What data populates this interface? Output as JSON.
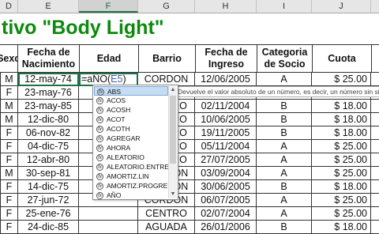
{
  "columns": [
    {
      "letter": "D",
      "active": false
    },
    {
      "letter": "E",
      "active": false
    },
    {
      "letter": "F",
      "active": true
    },
    {
      "letter": "G",
      "active": false
    },
    {
      "letter": "H",
      "active": false
    },
    {
      "letter": "I",
      "active": false
    },
    {
      "letter": "J",
      "active": false
    }
  ],
  "title": "tivo \"Body Light\"",
  "headers": [
    "Sexo",
    "Fecha de Nacimiento",
    "Edad",
    "Barrio",
    "Fecha de Ingreso",
    "Categoria de Socio",
    "Cuota"
  ],
  "rows": [
    [
      "M",
      "12-may-74",
      "",
      "CORDON",
      "12/06/2005",
      "A",
      "$ 25.00"
    ],
    [
      "F",
      "23-may-76",
      "",
      "",
      "",
      "",
      ""
    ],
    [
      "M",
      "23-may-85",
      "",
      "CENTRO",
      "02/11/2004",
      "B",
      "$ 18.00"
    ],
    [
      "M",
      "12-dic-80",
      "",
      "CENTRO",
      "10/06/2005",
      "B",
      "$ 18.00"
    ],
    [
      "F",
      "06-nov-82",
      "",
      "CENTRO",
      "19/11/2005",
      "B",
      "$ 18.00"
    ],
    [
      "F",
      "04-dic-75",
      "",
      "CENTRO",
      "05/11/2004",
      "A",
      "$ 25.00"
    ],
    [
      "F",
      "12-abr-80",
      "",
      "CENTRO",
      "27/07/2005",
      "A",
      "$ 25.00"
    ],
    [
      "M",
      "30-sep-81",
      "",
      "CORDON",
      "03/09/2004",
      "A",
      "$ 25.00"
    ],
    [
      "F",
      "14-dic-75",
      "",
      "CORDON",
      "30/06/2005",
      "B",
      "$ 18.00"
    ],
    [
      "F",
      "27-jun-72",
      "",
      "CORDON",
      "06/07/2005",
      "A",
      "$ 25.00"
    ],
    [
      "F",
      "25-ene-76",
      "",
      "CENTRO",
      "02/07/2004",
      "A",
      "$ 25.00"
    ],
    [
      "F",
      "24-dic-85",
      "",
      "AGUADA",
      "26/01/2006",
      "B",
      "$ 18.00"
    ]
  ],
  "formula": {
    "fn": "=aÑO(",
    "arg": "E5",
    "close": ")"
  },
  "tooltip": "Devuelve el valor absoluto de un número, es decir, un número sin signo.",
  "autocomplete": {
    "items": [
      "ABS",
      "ACOS",
      "ACOSH",
      "ACOT",
      "ACOTH",
      "AGREGAR",
      "AHORA",
      "ALEATORIO",
      "ALEATORIO.ENTRE",
      "AMORTIZ.LIN",
      "AMORTIZ.PROGRE",
      "AÑO"
    ],
    "selected_index": 0,
    "icon_glyph": "fx"
  }
}
